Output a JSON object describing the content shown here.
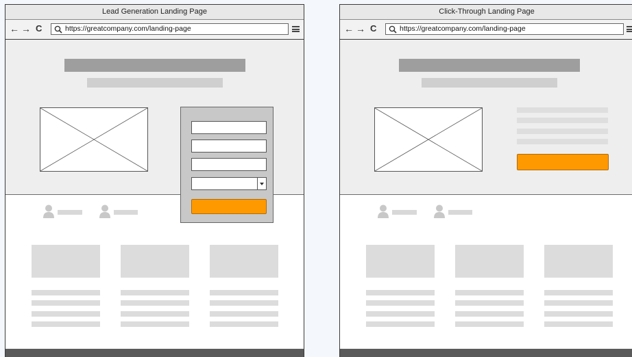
{
  "lead_page": {
    "title": "Lead Generation Landing Page",
    "url": "https://greatcompany.com/landing-page",
    "nav": {
      "back": "←",
      "forward": "→",
      "reload": "C"
    },
    "icons": [
      "arrow-left-icon",
      "arrow-right-icon",
      "reload-icon",
      "search-icon",
      "hamburger-menu-icon",
      "user-icon",
      "image-placeholder-icon",
      "dropdown-arrow-icon"
    ],
    "form_fields": 4,
    "has_dropdown": true
  },
  "click_page": {
    "title": "Click-Through Landing Page",
    "url": "https://greatcompany.com/landing-page",
    "nav": {
      "back": "←",
      "forward": "→",
      "reload": "C"
    },
    "icons": [
      "arrow-left-icon",
      "arrow-right-icon",
      "reload-icon",
      "search-icon",
      "hamburger-menu-icon",
      "user-icon",
      "image-placeholder-icon"
    ]
  },
  "colors": {
    "cta": "#ff9900",
    "headline_bar": "#9e9e9e",
    "hero_bg": "#eeeeee",
    "footer": "#5a5a5a",
    "placeholder": "#dcdcdc"
  }
}
